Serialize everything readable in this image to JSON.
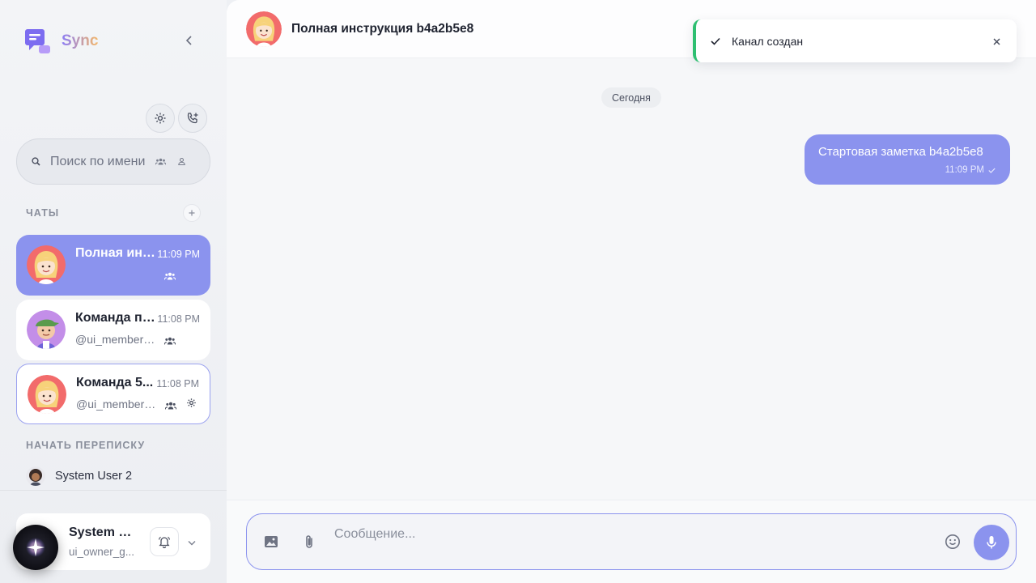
{
  "brand": {
    "name": "Sync"
  },
  "search": {
    "placeholder": "Поиск по имени"
  },
  "sections": {
    "chats": "ЧАТЫ",
    "start": "НАЧАТЬ ПЕРЕПИСКУ"
  },
  "chats": [
    {
      "name": "Полная инструкция b4a2b5e8",
      "time": "11:09 PM",
      "sub": ""
    },
    {
      "name": "Команда по проекту",
      "time": "11:08 PM",
      "sub": "@ui_member_..."
    },
    {
      "name": "Команда 5...",
      "time": "11:08 PM",
      "sub": "@ui_member_..."
    }
  ],
  "start_users": [
    {
      "name": "System User 2"
    }
  ],
  "profile": {
    "name": "System User",
    "handle": "ui_owner_g..."
  },
  "header": {
    "title": "Полная инструкция b4a2b5e8"
  },
  "toast": {
    "message": "Канал создан"
  },
  "conversation": {
    "date_label": "Сегодня",
    "messages": [
      {
        "text": "Стартовая заметка b4a2b5e8",
        "time": "11:09 PM"
      }
    ]
  },
  "composer": {
    "placeholder": "Сообщение..."
  },
  "colors": {
    "accent": "#8b93ee",
    "success": "#2fbf71"
  }
}
